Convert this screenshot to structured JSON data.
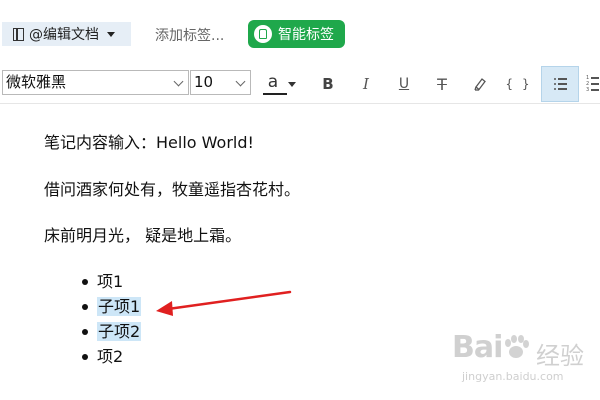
{
  "topbar": {
    "notebook_label": "@编辑文档",
    "add_tag_placeholder": "添加标签...",
    "smart_tag_label": "智能标签"
  },
  "toolbar": {
    "font_family": "微软雅黑",
    "font_size": "10",
    "font_color_label": "a",
    "bold_label": "B",
    "italic_label": "I",
    "underline_label": "U",
    "strike_label": "T",
    "code_label": "{ }",
    "active_tool": "bulleted-list",
    "icons": [
      "notebook-icon",
      "dropdown-icon",
      "tag-icon",
      "font-color-icon",
      "bold-icon",
      "italic-icon",
      "underline-icon",
      "strikethrough-icon",
      "highlighter-icon",
      "code-icon",
      "bulleted-list-icon",
      "numbered-list-icon"
    ]
  },
  "content": {
    "paragraphs": [
      "笔记内容输入：Hello World!",
      "借问酒家何处有，牧童遥指杏花村。",
      "床前明月光，  疑是地上霜。"
    ],
    "list_items": [
      {
        "label": "项1",
        "highlighted": false
      },
      {
        "label": "子项1",
        "highlighted": true
      },
      {
        "label": "子项2",
        "highlighted": true
      },
      {
        "label": "项2",
        "highlighted": false
      }
    ]
  },
  "annotation": {
    "arrow_color": "#e02020"
  },
  "watermark": {
    "brand_left": "Bai",
    "brand_right": "经验",
    "subtext": "jingyan.baidu.com"
  },
  "colors": {
    "accent_green": "#1fa84b",
    "highlight": "#cde6f7",
    "active_tool_bg": "#d7e9f6"
  }
}
